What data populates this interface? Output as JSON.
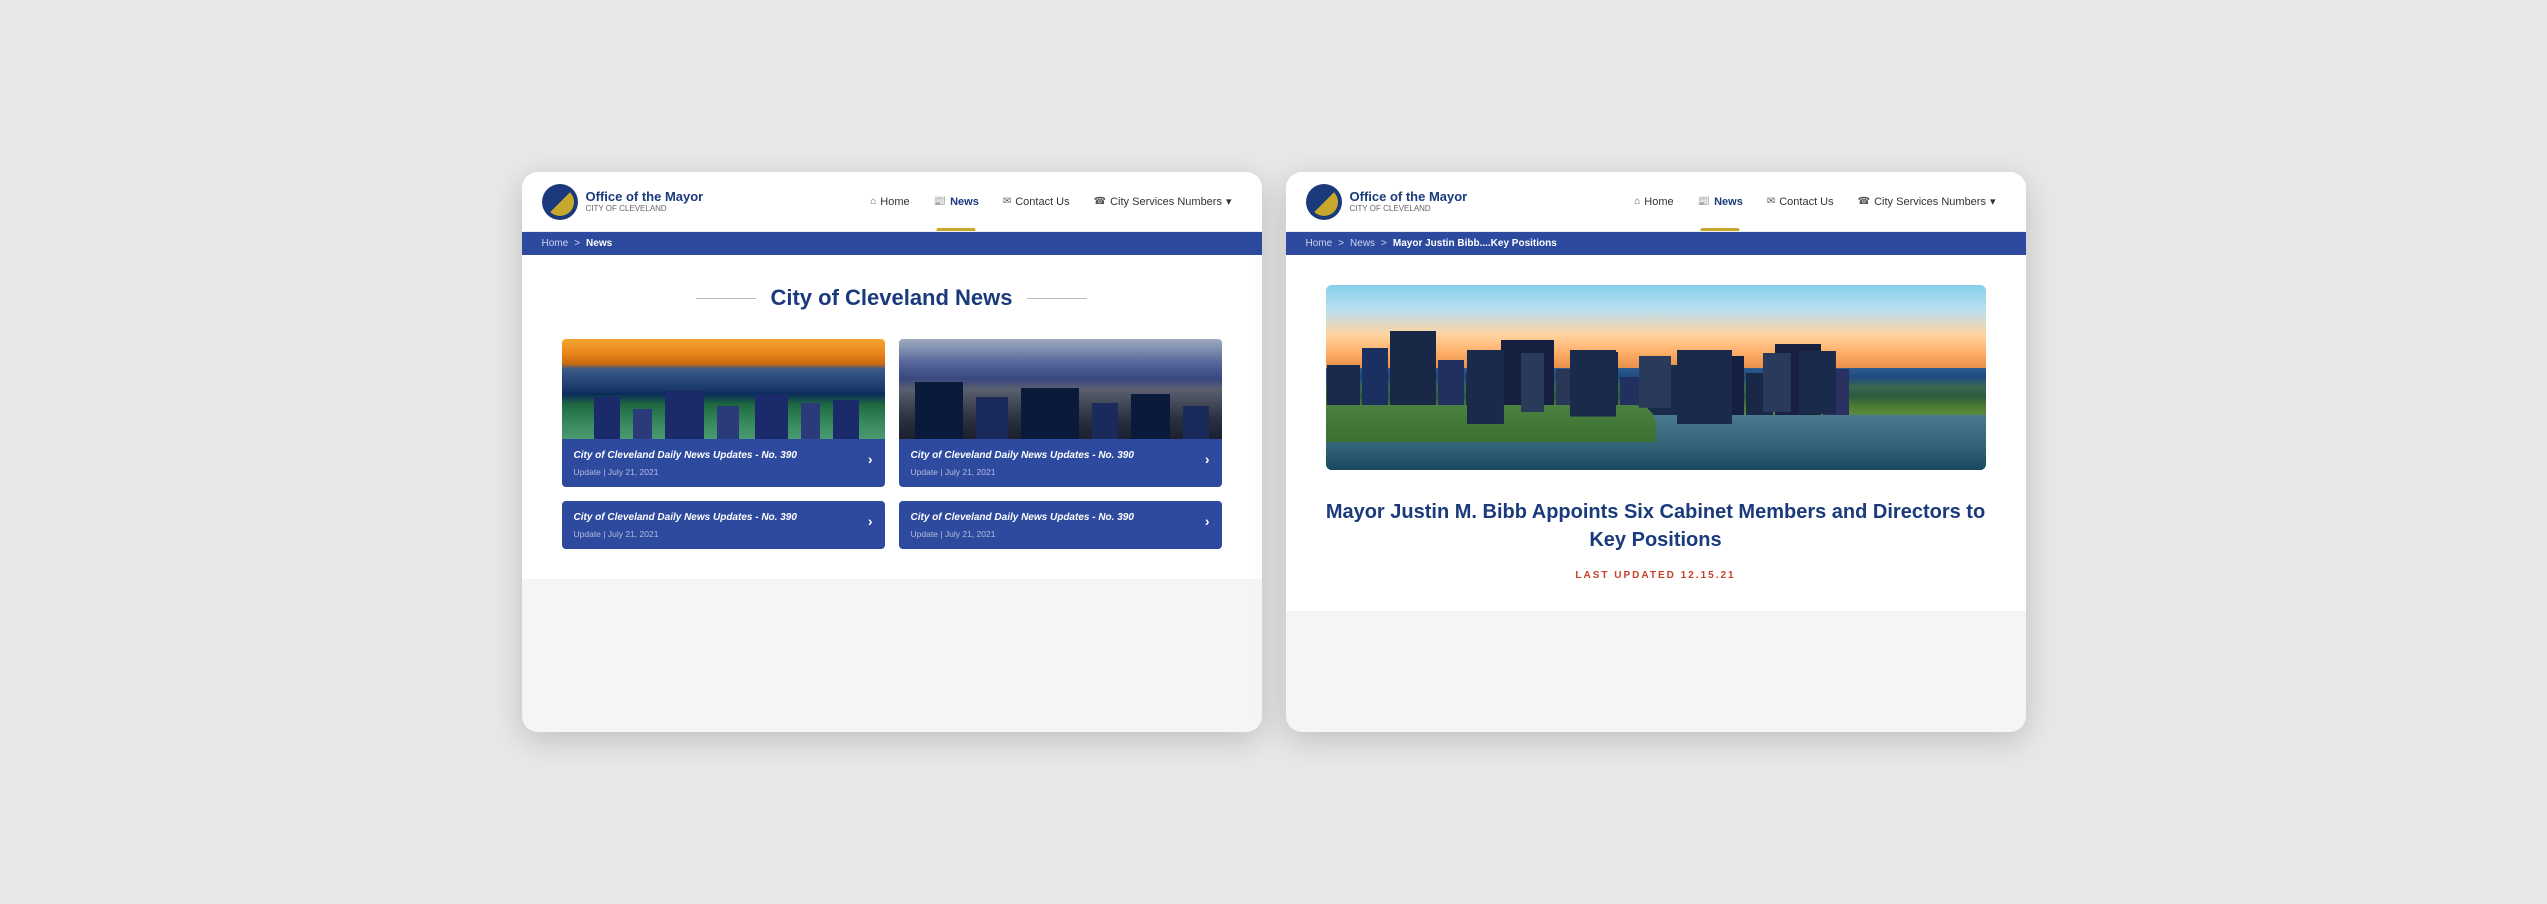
{
  "left_screen": {
    "header": {
      "logo_title": "Office of the Mayor",
      "logo_subtitle": "CITY OF CLEVELAND",
      "nav": {
        "home": "Home",
        "news": "News",
        "contact": "Contact Us",
        "city_services": "City Services Numbers"
      }
    },
    "breadcrumb": {
      "home": "Home",
      "separator": ">",
      "current": "News"
    },
    "main": {
      "page_title": "City of Cleveland News",
      "cards": [
        {
          "title": "City of Cleveland Daily News Updates - No. 390",
          "type": "Update",
          "date": "July 21, 2021",
          "arrow": "›"
        },
        {
          "title": "City of Cleveland Daily News Updates - No. 390",
          "type": "Update",
          "date": "July 21, 2021",
          "arrow": "›"
        },
        {
          "title": "City of Cleveland Daily News Updates - No. 390",
          "type": "Update",
          "date": "July 21, 2021",
          "arrow": "›"
        },
        {
          "title": "City of Cleveland Daily News Updates - No. 390",
          "type": "Update",
          "date": "July 21, 2021",
          "arrow": "›"
        }
      ]
    }
  },
  "right_screen": {
    "header": {
      "logo_title": "Office of the Mayor",
      "logo_subtitle": "CITY OF CLEVELAND",
      "nav": {
        "home": "Home",
        "news": "News",
        "contact": "Contact Us",
        "city_services": "City Services Numbers"
      }
    },
    "breadcrumb": {
      "home": "Home",
      "separator1": ">",
      "news": "News",
      "separator2": ">",
      "current": "Mayor Justin Bibb....Key Positions"
    },
    "main": {
      "article_title": "Mayor Justin M. Bibb Appoints Six Cabinet Members and Directors to Key Positions",
      "last_updated_label": "LAST UPDATED 12.15.21"
    }
  },
  "icons": {
    "home": "⌂",
    "news": "📰",
    "contact": "✉",
    "phone": "☎",
    "chevron": "▾",
    "arrow_right": "›"
  },
  "colors": {
    "navy": "#1a3a7c",
    "mid_blue": "#2d4a9e",
    "gold": "#c8a82c",
    "breadcrumb_bg": "#2d4a9e",
    "red_date": "#c8402a",
    "card_bg": "#2d4a9e",
    "text_light": "#b0bce0",
    "white": "#ffffff"
  }
}
